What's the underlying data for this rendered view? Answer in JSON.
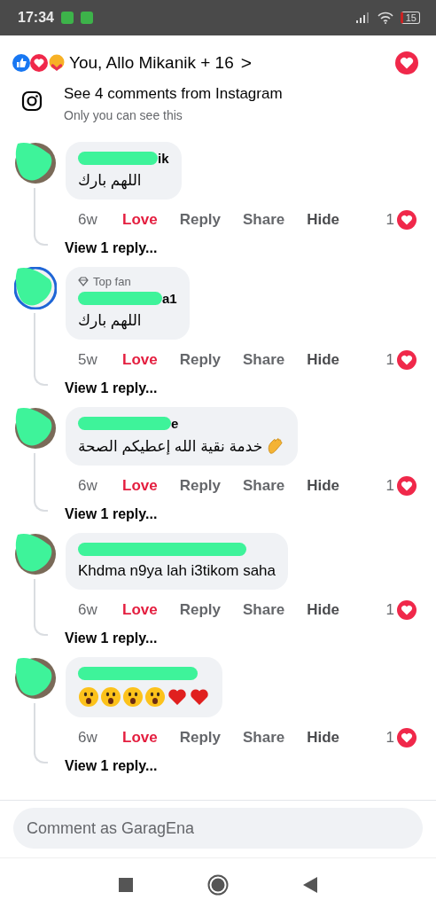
{
  "status_bar": {
    "time": "17:34",
    "battery": "15"
  },
  "reactions_summary": {
    "text": "You, Allo Mikanik + 16",
    "chevron": ">"
  },
  "instagram": {
    "title": "See 4 comments from Instagram",
    "subtitle": "Only you can see this"
  },
  "comments": [
    {
      "name_fragment": "ik",
      "text": "اللهم بارك",
      "time": "6w",
      "reaction_label": "Love",
      "reacted": true,
      "reply": "Reply",
      "share": "Share",
      "hide": "Hide",
      "reaction_count": "1",
      "view_replies": "View 1 reply..."
    },
    {
      "badge": "Top fan",
      "name_fragment": "a1",
      "text": "اللهم بارك",
      "time": "5w",
      "reaction_label": "Love",
      "reacted": true,
      "reply": "Reply",
      "share": "Share",
      "hide": "Hide",
      "reaction_count": "1",
      "view_replies": "View 1 reply..."
    },
    {
      "name_fragment": "e",
      "text": "خدمة نقية الله إعطيكم الصحة",
      "trailing_emoji": {
        "kind": "clap"
      },
      "time": "6w",
      "reaction_label": "Love",
      "reacted": true,
      "reply": "Reply",
      "share": "Share",
      "hide": "Hide",
      "reaction_count": "1",
      "view_replies": "View 1 reply..."
    },
    {
      "text": "Khdma n9ya lah i3tikom saha",
      "time": "6w",
      "reaction_label": "Love",
      "reacted": true,
      "reply": "Reply",
      "share": "Share",
      "hide": "Hide",
      "reaction_count": "1",
      "view_replies": "View 1 reply..."
    },
    {
      "emojis": [
        {
          "kind": "wow"
        },
        {
          "kind": "wow"
        },
        {
          "kind": "wow"
        },
        {
          "kind": "wow"
        },
        {
          "kind": "heart"
        },
        {
          "kind": "heart"
        }
      ],
      "time": "6w",
      "reaction_label": "Love",
      "reacted": true,
      "reply": "Reply",
      "share": "Share",
      "hide": "Hide",
      "reaction_count": "1",
      "view_replies": "View 1 reply..."
    }
  ],
  "comment_field": {
    "placeholder": "Comment as GaragEna"
  }
}
